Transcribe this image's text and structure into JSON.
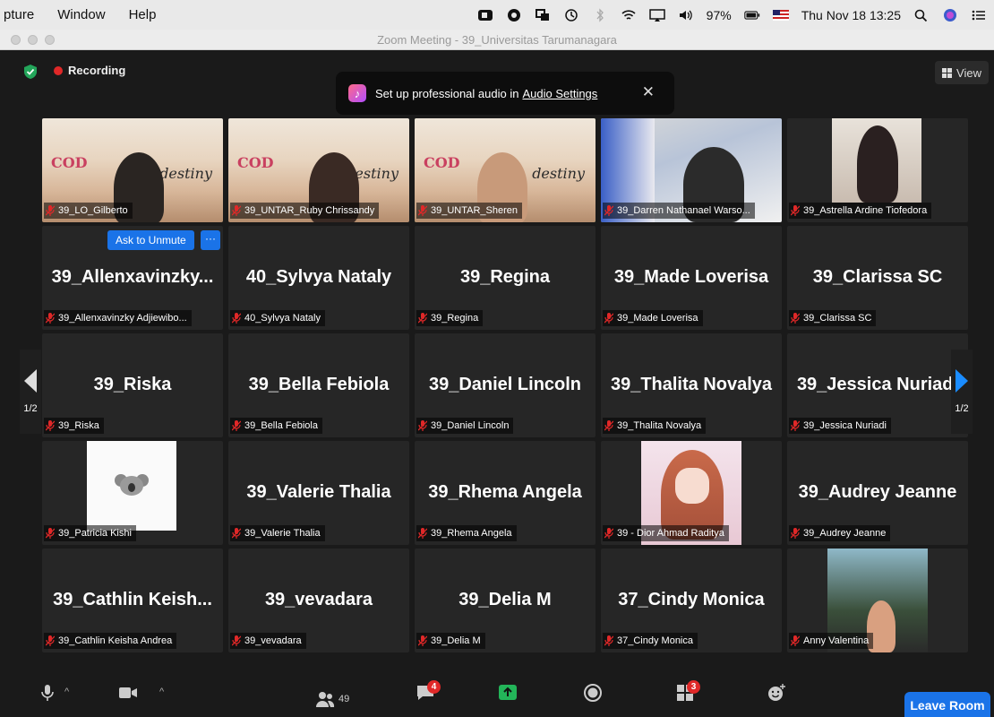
{
  "menubar": {
    "items": [
      "pture",
      "Window",
      "Help"
    ],
    "battery": "97%",
    "datetime": "Thu Nov 18  13:25"
  },
  "window": {
    "title": "Zoom Meeting - 39_Universitas Tarumanagara"
  },
  "top": {
    "recording": "Recording",
    "view": "View",
    "banner_text": "Set up professional audio in",
    "banner_link": "Audio Settings"
  },
  "colors": {
    "accent": "#1a73e8",
    "recording": "#e02828",
    "active_speaker": "#a5d36b",
    "muted": "#e02828"
  },
  "gallery": {
    "page_indicator": "1/2",
    "ask_to_unmute": "Ask to Unmute",
    "more": "···",
    "tiles": [
      {
        "big": "",
        "label": "39_LO_Gilberto",
        "video": "slide"
      },
      {
        "big": "",
        "label": "39_UNTAR_Ruby Chrissandy",
        "video": "slide"
      },
      {
        "big": "",
        "label": "39_UNTAR_Sheren",
        "video": "slide"
      },
      {
        "big": "",
        "label": "39_Darren Nathanael Warso...",
        "video": "room"
      },
      {
        "big": "",
        "label": "39_Astrella Ardine Tiofedora",
        "video": "photo"
      },
      {
        "big": "39_Allenxavinzky...",
        "label": "39_Allenxavinzky Adjiewibo..."
      },
      {
        "big": "40_Sylvya Nataly",
        "label": "40_Sylvya Nataly"
      },
      {
        "big": "39_Regina",
        "label": "39_Regina"
      },
      {
        "big": "39_Made Loverisa",
        "label": "39_Made Loverisa"
      },
      {
        "big": "39_Clarissa SC",
        "label": "39_Clarissa SC"
      },
      {
        "big": "39_Riska",
        "label": "39_Riska"
      },
      {
        "big": "39_Bella Febiola",
        "label": "39_Bella Febiola"
      },
      {
        "big": "39_Daniel Lincoln",
        "label": "39_Daniel Lincoln"
      },
      {
        "big": "39_Thalita Novalya",
        "label": "39_Thalita Novalya"
      },
      {
        "big": "39_Jessica Nuriadi",
        "label": "39_Jessica Nuriadi"
      },
      {
        "big": "",
        "label": "39_Patricia Kishi",
        "video": "koala"
      },
      {
        "big": "39_Valerie Thalia",
        "label": "39_Valerie Thalia"
      },
      {
        "big": "39_Rhema Angela",
        "label": "39_Rhema Angela"
      },
      {
        "big": "",
        "label": "39 - Dior Ahmad Raditya",
        "video": "anime"
      },
      {
        "big": "39_Audrey Jeanne",
        "label": "39_Audrey Jeanne"
      },
      {
        "big": "39_Cathlin Keish...",
        "label": "39_Cathlin Keisha Andrea"
      },
      {
        "big": "39_vevadara",
        "label": "39_vevadara"
      },
      {
        "big": "39_Delia M",
        "label": "39_Delia M"
      },
      {
        "big": "37_Cindy Monica",
        "label": "37_Cindy Monica"
      },
      {
        "big": "",
        "label": "Anny Valentina",
        "video": "tree"
      }
    ]
  },
  "toolbar": {
    "participants_count": "49",
    "chat_badge": "4",
    "breakout_badge": "3",
    "leave": "Leave Room"
  }
}
